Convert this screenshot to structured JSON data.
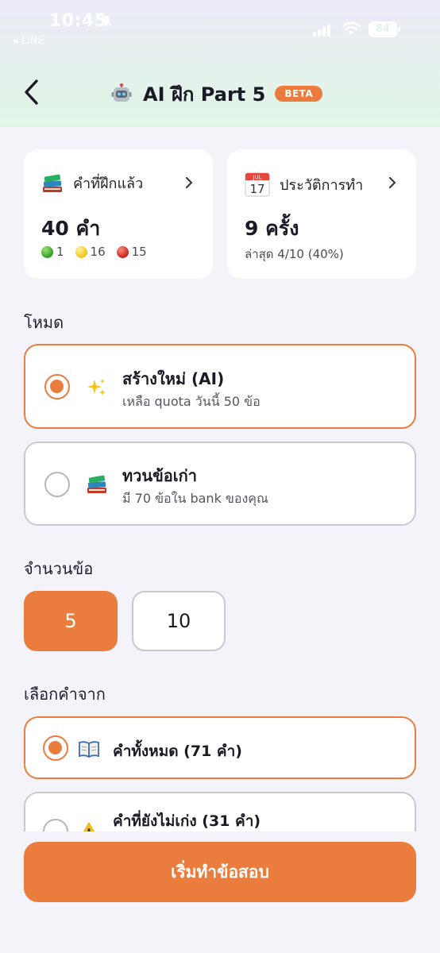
{
  "status_bar": {
    "time": "10:45",
    "back_app": "◂ LINE",
    "battery": "84"
  },
  "header": {
    "title": "AI ฝึก Part 5",
    "badge": "BETA"
  },
  "stats": {
    "practiced": {
      "label": "คำที่ฝึกแล้ว",
      "value": "40 คำ",
      "green_count": "1",
      "yellow_count": "16",
      "red_count": "15"
    },
    "history": {
      "label": "ประวัติการทำ",
      "value": "9 ครั้ง",
      "latest": "ล่าสุด 4/10 (40%)",
      "calendar_month": "JUL",
      "calendar_day": "17"
    }
  },
  "mode": {
    "label": "โหมด",
    "options": [
      {
        "title": "สร้างใหม่ (AI)",
        "subtitle": "เหลือ quota วันนี้ 50 ข้อ",
        "selected": true,
        "icon": "sparkles-icon"
      },
      {
        "title": "ทวนข้อเก่า",
        "subtitle": "มี 70 ข้อใน bank ของคุณ",
        "selected": false,
        "icon": "books-icon"
      }
    ]
  },
  "count": {
    "label": "จำนวนข้อ",
    "options": [
      "5",
      "10"
    ],
    "selected": "5"
  },
  "source": {
    "label": "เลือกคำจาก",
    "options": [
      {
        "title": "คำทั้งหมด (71 คำ)",
        "selected": true,
        "icon": "open-book-icon"
      },
      {
        "title": "คำที่ยังไม่เก่ง (31 คำ)",
        "selected": false,
        "icon": "warning-icon"
      }
    ]
  },
  "start_button": "เริ่มทำข้อสอบ",
  "colors": {
    "accent": "#ea7d3d",
    "background": "#f4f3fa",
    "card": "#ffffff"
  }
}
